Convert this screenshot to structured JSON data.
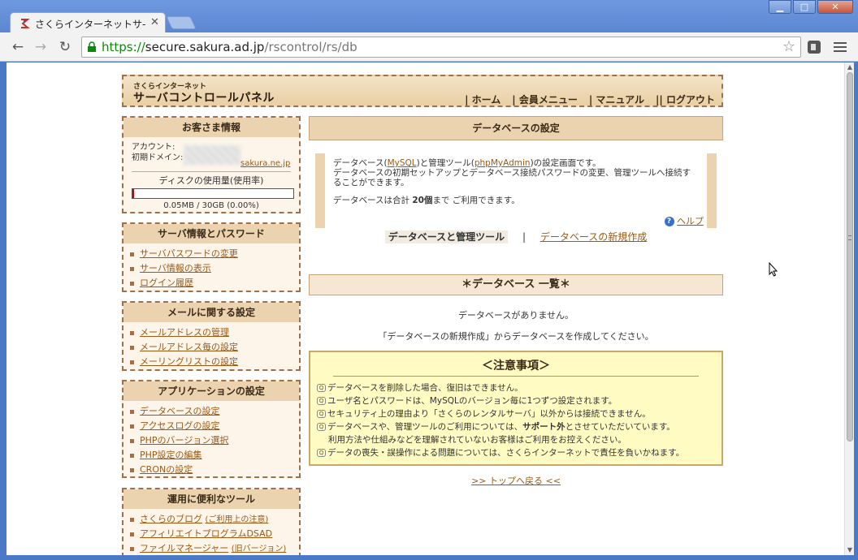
{
  "browser": {
    "tab_title": "さくらインターネットサ-",
    "url_scheme": "https://",
    "url_host": "secure.sakura.ad.jp",
    "url_path": "/rscontrol/rs/db",
    "win_min": "▁",
    "win_max": "□",
    "win_close": "✕",
    "icons": {
      "back": "back-arrow-icon",
      "forward": "forward-arrow-icon",
      "reload": "reload-icon",
      "lock": "lock-icon",
      "star": "bookmark-star-icon",
      "menu": "menu-icon"
    }
  },
  "header": {
    "logo_small": "さくらインターネット",
    "logo_main": "サーバコントロールパネル",
    "nav": [
      "| ホーム",
      "| 会員メニュー",
      "| マニュアル",
      "|| ログアウト"
    ]
  },
  "customer": {
    "title": "お客さま情報",
    "account_label": "アカウント:",
    "domain_label": "初期ドメイン:",
    "domain_value": "sakura.ne.jp",
    "disk_label": "ディスクの使用量(使用率)",
    "disk_usage": "0.05MB / 30GB (0.00%)",
    "disk_fraction": 0.0
  },
  "server_info": {
    "title": "サーバ情報とパスワード",
    "items": [
      "サーバパスワードの変更",
      "サーバ情報の表示",
      "ログイン履歴"
    ]
  },
  "mail": {
    "title": "メールに関する設定",
    "items": [
      "メールアドレスの管理",
      "メールアドレス毎の設定",
      "メーリングリストの設定"
    ]
  },
  "apps": {
    "title": "アプリケーションの設定",
    "items": [
      "データベースの設定",
      "アクセスログの設定",
      "PHPのバージョン選択",
      "PHP設定の編集",
      "CRONの設定"
    ]
  },
  "tools": {
    "title": "運用に便利なツール",
    "items": [
      {
        "label": "さくらのブログ",
        "note": "(ご利用上の注意)"
      },
      {
        "label": "アフィリエイトプログラムDSAD",
        "note": ""
      },
      {
        "label": "ファイルマネージャー",
        "note": "(旧バージョン)"
      }
    ]
  },
  "main": {
    "title": "データベースの設定",
    "desc_pre": "データベース(",
    "desc_mysql": "MySQL",
    "desc_mid": ")と管理ツール(",
    "desc_pma": "phpMyAdmin",
    "desc_post": ")の設定画面です。",
    "desc_line2": "データベースの初期セットアップとデータベース接続パスワードの変更、管理ツールへ接続することができます。",
    "limit_pre": "データベースは合計 ",
    "limit_count": "20個",
    "limit_post": "まで ご利用できます。",
    "help": "ヘルプ",
    "subnav_active": "データベースと管理ツール",
    "subnav_sep": "|",
    "subnav_new": "データベースの新規作成",
    "list_title": "＊データベース 一覧＊",
    "empty": "データベースがありません。",
    "create_hint": "「データベースの新規作成」からデータベースを作成してください。",
    "back_top": ">> トップへ戻る <<"
  },
  "notice": {
    "title": "＜注意事項＞",
    "items": [
      "データベースを削除した場合、復旧はできません。",
      "ユーザ名とパスワードは、MySQLのバージョン毎に1つずつ設定されます。",
      "セキュリティ上の理由より「さくらのレンタルサーバ」以外からは接続できません。"
    ],
    "support_pre": "データベースや、管理ツールのご利用については、",
    "support_bold": "サポート外",
    "support_post": "とさせていただいています。",
    "support_sub": "利用方法や仕組みなどを理解されていないお客様はご利用をお控えください。",
    "last": "データの喪失・誤操作による問題については、さくらインターネットで責任を負いかねます。"
  }
}
